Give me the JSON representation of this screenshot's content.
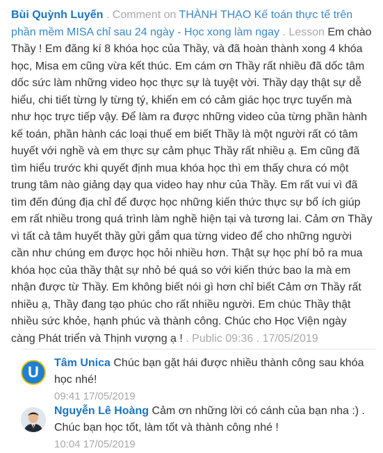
{
  "comment": {
    "author": "Bùi Quỳnh Luyến",
    "meta_prefix": " . Comment on ",
    "course_title": "THÀNH THẠO Kế toán thực tế trên phần mềm MISA chỉ sau 24 ngày - Học xong làm ngay",
    "lesson_label": " . Lesson ",
    "body": "Em chào Thầy ! Em đăng kí 8 khóa học của Thầy, và đã hoàn thành xong 4 khóa học, Misa em cũng vừa kết thúc. Em cám ơn Thầy rất nhiều đã dốc tâm dốc sức làm những video học thực sự là tuyệt vời. Thầy dạy thật sự dễ hiểu, chi tiết từng ly từng tý, khiến em có cảm giác học trực tuyến mà như học trực tiếp vậy. Để làm ra được những video của từng phần hành kế toán, phần hành các loại thuế em biết Thầy là một người rất có tâm huyết với nghề và em thực sự cảm phục Thầy rất nhiều ạ. Em cũng đã tìm hiểu trước khi quyết định mua khóa học thì em thấy chưa có một trung tâm nào giảng dạy qua video hay như của Thầy. Em rất vui vì đã tìm đến đúng địa chỉ để được học những kiến thức thực sự bổ ích giúp em rất nhiều trong quá trình làm nghề hiện tại và tương lai. Cảm ơn Thầy vì tất cả tâm huyết thầy gửi gắm qua từng video để cho những người cần như chúng em được học hỏi nhiều hơn. Thật sự học phí bỏ ra mua khóa học của thầy thật sự nhỏ bé quá so với kiến thức bao la mà em nhận được từ Thầy. Em không biết nói gì hơn chỉ biết Cảm ơn Thầy rất nhiều ạ, Thầy đang tạo phúc cho rất nhiều người. Em chúc Thầy thật nhiều sức khỏe, hạnh phúc và thành công. Chúc cho Học Viện ngày càng Phát triển và Thịnh vượng ạ !",
    "status": " . Public 09:36 . ",
    "date": "17/05/2019"
  },
  "replies": [
    {
      "avatar_letter": "U",
      "author": "Tâm Unica",
      "text": "Chúc bạn gặt hái được nhiều thành công sau khóa học nhé!",
      "time": "09:41 17/05/2019",
      "avatar_icon": "unica-logo-icon"
    },
    {
      "author": "Nguyễn Lê Hoàng",
      "text": "Cảm ơn những lời có cánh của bạn nha :) . Chúc bạn học tốt, làm tốt và thành công nhé !",
      "time": "10:04 17/05/2019",
      "avatar_icon": "user-photo-icon"
    }
  ],
  "colors": {
    "author": "#1a74c4",
    "link": "#3a87c8",
    "meta": "#a8a8a8",
    "body": "#333333",
    "avatar_u_bg": "#1e7fd3",
    "avatar_u_ring": "#f4c200"
  }
}
